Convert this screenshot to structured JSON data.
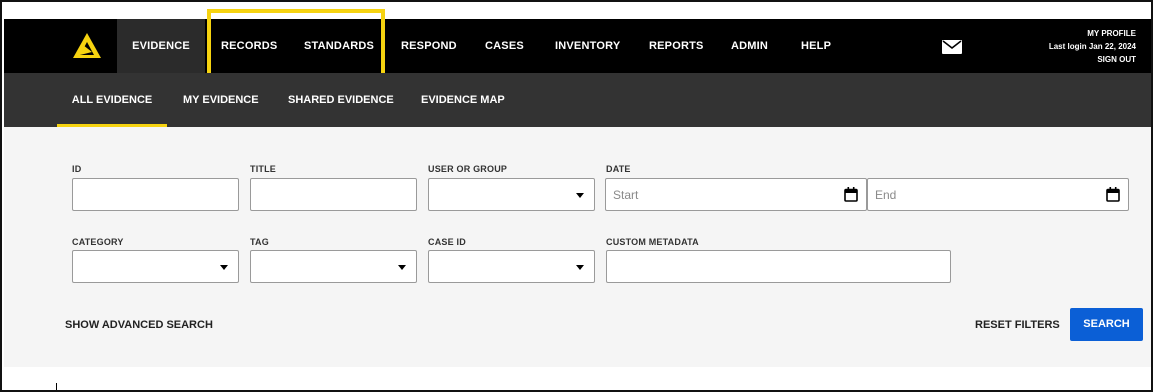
{
  "nav": {
    "items": [
      {
        "label": "EVIDENCE"
      },
      {
        "label": "RECORDS"
      },
      {
        "label": "STANDARDS"
      },
      {
        "label": "RESPOND"
      },
      {
        "label": "CASES"
      },
      {
        "label": "INVENTORY"
      },
      {
        "label": "REPORTS"
      },
      {
        "label": "ADMIN"
      },
      {
        "label": "HELP"
      }
    ],
    "mail_icon": "mail-icon",
    "logo_icon": "logo-icon"
  },
  "profile": {
    "my_profile": "MY PROFILE",
    "last_login": "Last login Jan 22, 2024",
    "sign_out": "SIGN OUT"
  },
  "subnav": {
    "items": [
      {
        "label": "ALL EVIDENCE"
      },
      {
        "label": "MY EVIDENCE"
      },
      {
        "label": "SHARED EVIDENCE"
      },
      {
        "label": "EVIDENCE MAP"
      }
    ]
  },
  "filters": {
    "id_label": "ID",
    "title_label": "TITLE",
    "user_group_label": "USER OR GROUP",
    "date_label": "DATE",
    "date_start_placeholder": "Start",
    "date_end_placeholder": "End",
    "category_label": "CATEGORY",
    "tag_label": "TAG",
    "case_id_label": "CASE ID",
    "custom_metadata_label": "CUSTOM METADATA"
  },
  "actions": {
    "show_advanced": "SHOW ADVANCED SEARCH",
    "reset_filters": "RESET FILTERS",
    "search": "SEARCH"
  },
  "colors": {
    "accent": "#f6d310",
    "primary_button": "#0b5fd6",
    "topnav_bg": "#000000",
    "subnav_bg": "#333333"
  }
}
